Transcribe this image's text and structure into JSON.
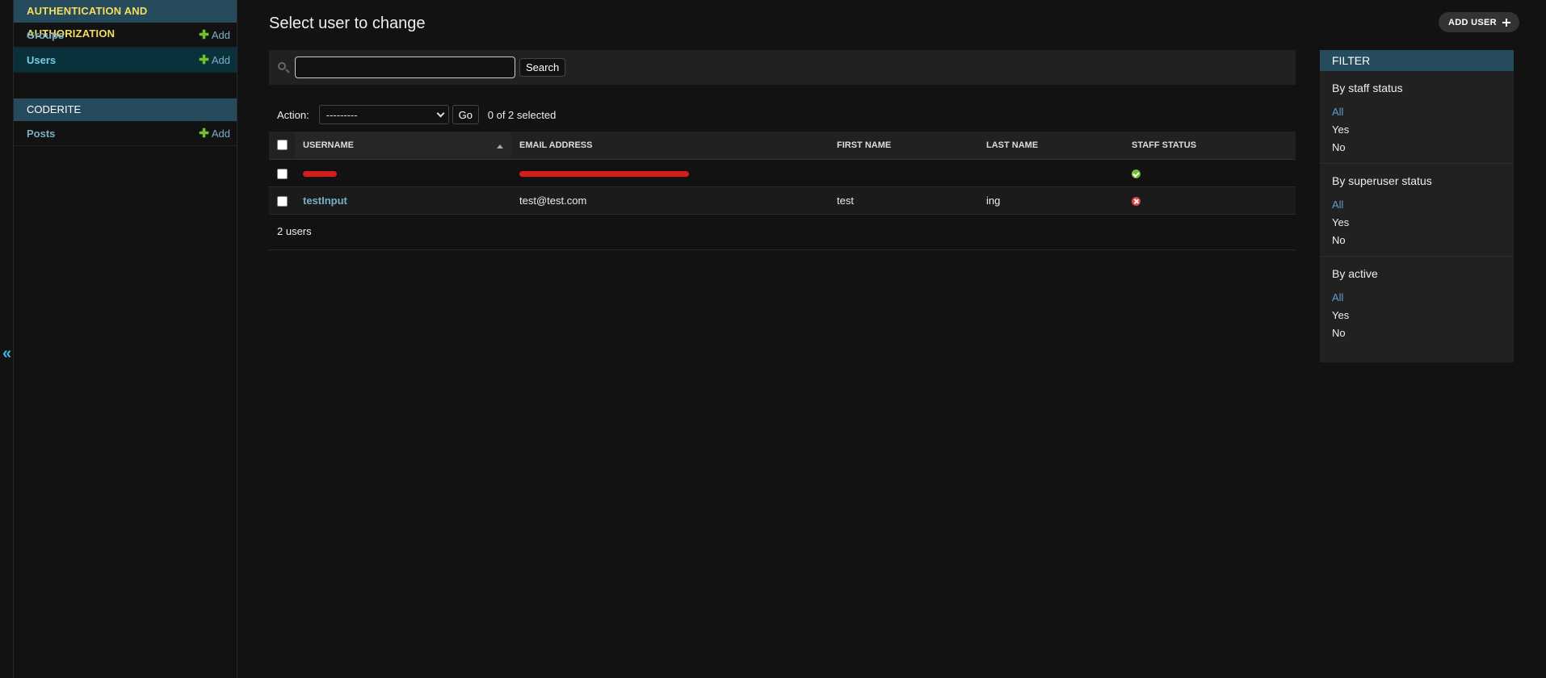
{
  "sidebar": {
    "collapse_glyph": "«",
    "modules": [
      {
        "caption": "AUTHENTICATION AND AUTHORIZATION",
        "models": [
          {
            "name": "Groups",
            "add_label": "Add",
            "current": false
          },
          {
            "name": "Users",
            "add_label": "Add",
            "current": true
          }
        ]
      },
      {
        "caption": "CODERITE",
        "models": [
          {
            "name": "Posts",
            "add_label": "Add",
            "current": false
          }
        ]
      }
    ]
  },
  "header": {
    "title": "Select user to change",
    "add_button_label": "ADD USER"
  },
  "search": {
    "value": "",
    "placeholder": "",
    "button_label": "Search"
  },
  "actions": {
    "label": "Action:",
    "selected_option": "---------",
    "go_label": "Go",
    "counter": "0 of 2 selected"
  },
  "table": {
    "columns": [
      "USERNAME",
      "EMAIL ADDRESS",
      "FIRST NAME",
      "LAST NAME",
      "STAFF STATUS"
    ],
    "rows": [
      {
        "username": "",
        "email": "",
        "first_name": "",
        "last_name": "",
        "staff_status": true,
        "redacted": true
      },
      {
        "username": "testInput",
        "email": "test@test.com",
        "first_name": "test",
        "last_name": "ing",
        "staff_status": false,
        "redacted": false
      }
    ],
    "result_count": "2 users"
  },
  "filter": {
    "title": "FILTER",
    "groups": [
      {
        "heading": "By staff status",
        "options": [
          "All",
          "Yes",
          "No"
        ],
        "selected": "All"
      },
      {
        "heading": "By superuser status",
        "options": [
          "All",
          "Yes",
          "No"
        ],
        "selected": "All"
      },
      {
        "heading": "By active",
        "options": [
          "All",
          "Yes",
          "No"
        ],
        "selected": "All"
      }
    ]
  },
  "colors": {
    "background": "#121212",
    "module_caption": "#264b5d",
    "link": "#79aec8",
    "add_plus": "#70bf2b",
    "status_yes": "#70bf2b",
    "status_no": "#dd4646",
    "redaction": "#d81c1c"
  },
  "icons": {
    "search": "search-icon",
    "sort": "sort-ascending-icon",
    "staff_yes": "check-circle-icon",
    "staff_no": "x-circle-icon",
    "add": "plus-icon",
    "collapse": "double-chevron-left-icon"
  }
}
